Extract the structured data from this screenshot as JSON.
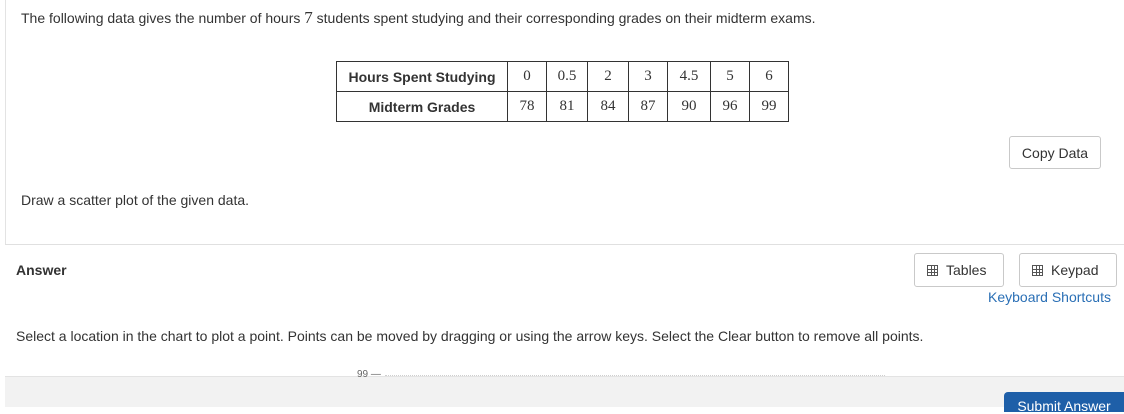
{
  "question": {
    "text_before": "The following data gives the number of hours ",
    "count": "7",
    "text_after": " students spent studying and their corresponding grades on their midterm exams."
  },
  "table": {
    "row1_header": "Hours Spent Studying",
    "row1_values": [
      "0",
      "0.5",
      "2",
      "3",
      "4.5",
      "5",
      "6"
    ],
    "row2_header": "Midterm Grades",
    "row2_values": [
      "78",
      "81",
      "84",
      "87",
      "90",
      "96",
      "99"
    ]
  },
  "copy_button": "Copy Data",
  "instruction": "Draw a scatter plot of the given data.",
  "answer_label": "Answer",
  "tables_button": "Tables",
  "keypad_button": "Keypad",
  "keyboard_shortcuts": "Keyboard Shortcuts",
  "select_instruction": "Select a location in the chart to plot a point. Points can be moved by dragging or using the arrow keys. Select the Clear button to remove all points.",
  "chart_tick_top": "99 —",
  "submit_button": "Submit Answer"
}
